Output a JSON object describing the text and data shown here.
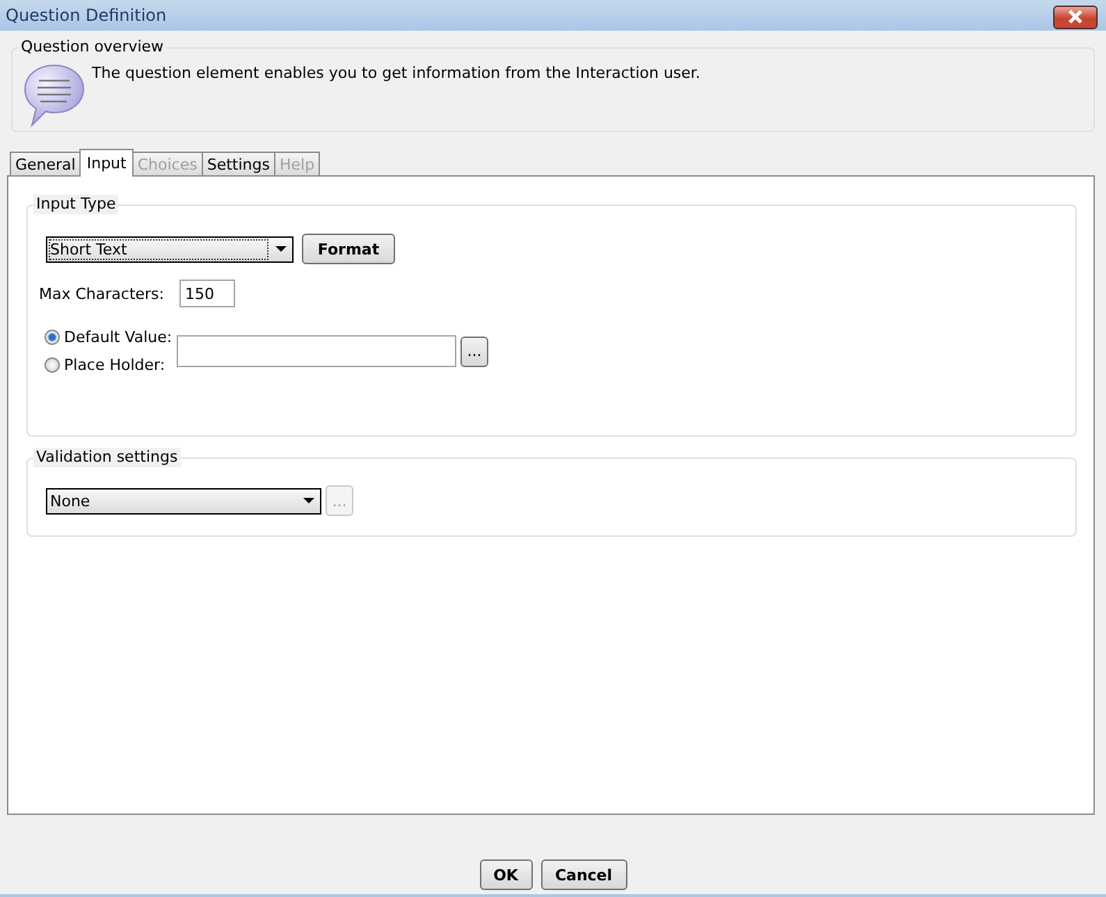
{
  "window": {
    "title": "Question Definition"
  },
  "overview": {
    "legend": "Question overview",
    "text": "The question element enables you to get information from the Interaction user."
  },
  "tabs": [
    {
      "label": "General",
      "selected": false,
      "disabled": false
    },
    {
      "label": "Input",
      "selected": true,
      "disabled": false
    },
    {
      "label": "Choices",
      "selected": false,
      "disabled": true
    },
    {
      "label": "Settings",
      "selected": false,
      "disabled": false
    },
    {
      "label": "Help",
      "selected": false,
      "disabled": true
    }
  ],
  "input_type": {
    "legend": "Input Type",
    "dropdown": "Short Text",
    "format_button": "Format",
    "max_label": "Max Characters:",
    "max_value": "150",
    "radios": [
      {
        "label": "Default Value:",
        "selected": true
      },
      {
        "label": "Place Holder:",
        "selected": false
      }
    ],
    "browse_button": {
      "label": "...",
      "disabled": false
    }
  },
  "validation": {
    "legend": "Validation settings",
    "dropdown": "None",
    "browse_button": {
      "label": "...",
      "disabled": true
    }
  },
  "buttons": [
    "OK",
    "Cancel"
  ]
}
